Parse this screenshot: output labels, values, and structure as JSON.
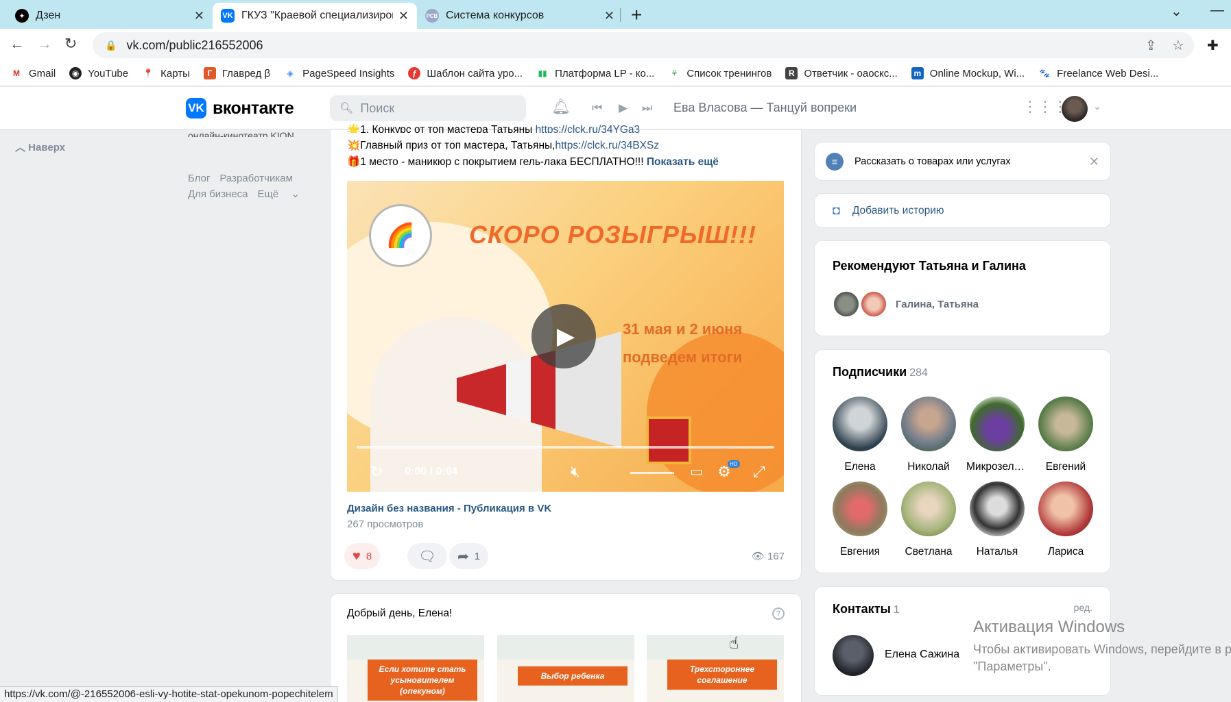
{
  "browser": {
    "tabs": [
      {
        "title": "Дзен",
        "active": false
      },
      {
        "title": "ГКУЗ \"Краевой специализирова",
        "active": true
      },
      {
        "title": "Система конкурсов",
        "active": false
      }
    ],
    "url": "vk.com/public216552006",
    "bookmarks": [
      "Gmail",
      "YouTube",
      "Карты",
      "Главред β",
      "PageSpeed Insights",
      "Шаблон сайта уро...",
      "Платформа LP - ко...",
      "Список тренингов",
      "Ответчик - oaocкс...",
      "Online Mockup, Wi...",
      "Freelance Web Desi..."
    ],
    "status_url": "https://vk.com/@-216552006-esli-vy-hotite-stat-opekunom-popechitelem"
  },
  "vk": {
    "logo_text": "вконтакте",
    "search_placeholder": "Поиск",
    "now_playing": "Ева Власова — Танцуй вопреки"
  },
  "leftnav": {
    "up_label": "Наверх",
    "cut_text": "онлайн-кинотеатр KION",
    "links": [
      "Блог",
      "Разработчикам",
      "Для бизнеса",
      "Ещё"
    ]
  },
  "post": {
    "line1_prefix": "🌟1. Конкурс от топ мастера Татьяны ",
    "line1_link": "https://clck.ru/34YGa3",
    "line2_prefix": "💥Главный приз от топ мастера, Татьяны,",
    "line2_link": "https://clck.ru/34BXSz",
    "line3": "🎁1 место - маникюр с покрытием гель-лака БЕСПЛАТНО!!! ",
    "show_more": "Показать ещё",
    "video": {
      "headline": "СКОРО РОЗЫГРЫШ!!!",
      "dates_line1": "31 мая и 2 июня",
      "dates_line2": "подведем итоги",
      "time": "0:00 / 0:04",
      "title": "Дизайн без названия - Публикация в VK",
      "views": "267 просмотров",
      "progress": 0
    },
    "likes": "8",
    "reposts": "1",
    "views": "167"
  },
  "post2": {
    "greeting": "Добрый день, Елена!",
    "thumbs": [
      "Если хотите стать усыновителем (опекуном)",
      "Выбор ребенка",
      "Трехстороннее соглашение"
    ]
  },
  "right": {
    "promo_text": "Рассказать о товарах или услугах",
    "story_text": "Добавить историю",
    "recommend_title": "Рекомендуют Татьяна и Галина",
    "recommend_names": "Галина, Татьяна",
    "subs_title": "Подписчики",
    "subs_count": "284",
    "subscribers": [
      "Елена",
      "Николай",
      "Микрозеле...",
      "Евгений",
      "Евгения",
      "Светлана",
      "Наталья",
      "Лариса"
    ],
    "contacts_title": "Контакты",
    "contacts_count": "1",
    "edit_label": "ред.",
    "contact_name": "Елена Сажина"
  },
  "watermark": {
    "line1": "Активация Windows",
    "line2": "Чтобы активировать Windows, перейдите в р",
    "line3": "\"Параметры\"."
  },
  "colors": {
    "vk_blue": "#0077ff",
    "link": "#2a5885",
    "like_red": "#e64646",
    "bg": "#edeef0"
  }
}
